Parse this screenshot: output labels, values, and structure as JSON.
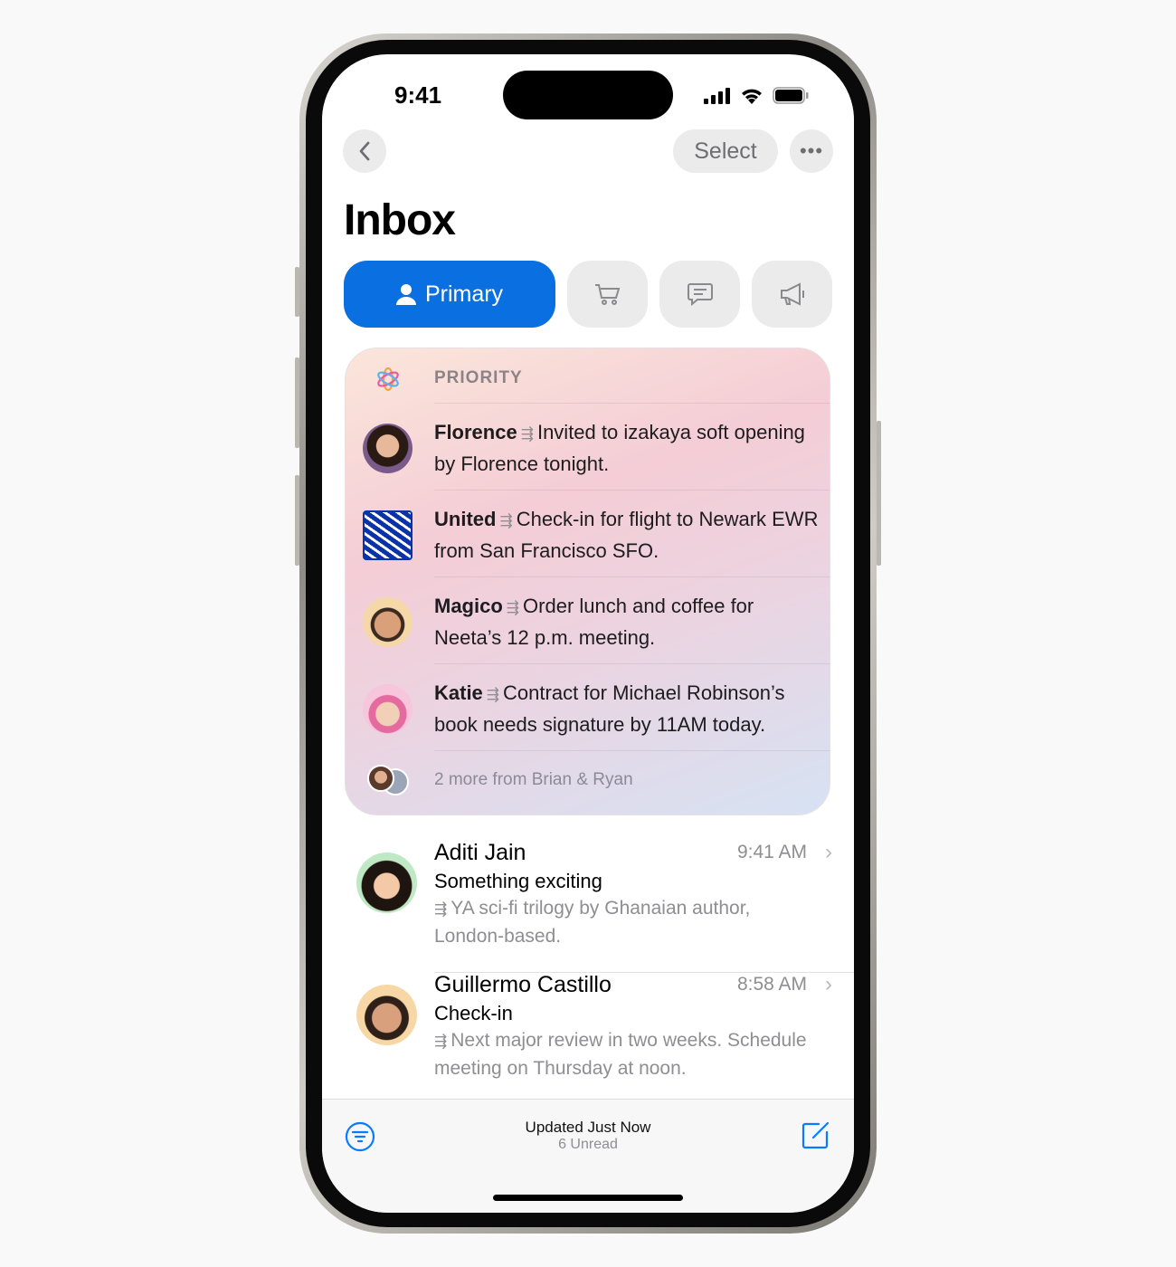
{
  "status_bar": {
    "time": "9:41"
  },
  "nav": {
    "select_label": "Select",
    "back_icon": "chevron-left-icon",
    "more_icon": "ellipsis-icon"
  },
  "header": {
    "title": "Inbox"
  },
  "tabs": [
    {
      "label": "Primary",
      "icon": "person-icon",
      "selected": true
    },
    {
      "icon": "cart-icon"
    },
    {
      "icon": "message-icon"
    },
    {
      "icon": "megaphone-icon"
    }
  ],
  "priority": {
    "label": "PRIORITY",
    "items": [
      {
        "sender": "Florence",
        "summary": "Invited to izakaya soft opening by Florence tonight."
      },
      {
        "sender": "United",
        "summary": "Check-in for flight to Newark EWR from San Francisco SFO."
      },
      {
        "sender": "Magico",
        "summary": "Order lunch and coffee for Neeta’s 12 p.m. meeting."
      },
      {
        "sender": "Katie",
        "summary": "Contract for Michael Robinson’s book needs signature by 11AM today."
      }
    ],
    "more": "2 more from Brian & Ryan"
  },
  "messages": [
    {
      "sender": "Aditi Jain",
      "time": "9:41 AM",
      "subject": "Something exciting",
      "preview": "YA sci-fi trilogy by Ghanaian author, London-based."
    },
    {
      "sender": "Guillermo Castillo",
      "time": "8:58 AM",
      "subject": "Check-in",
      "preview": "Next major review in two weeks. Schedule meeting on Thursday at noon."
    }
  ],
  "toolbar": {
    "status": "Updated Just Now",
    "unread": "6 Unread",
    "accent": "#0a7aff"
  },
  "colors": {
    "primary_tab": "#0a6fe0"
  }
}
